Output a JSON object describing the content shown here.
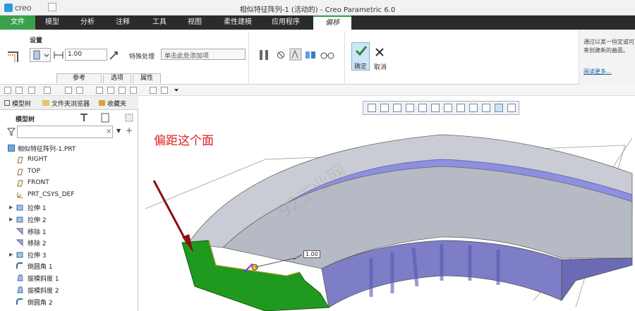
{
  "titlebar": {
    "logo": "creo",
    "title": "相似特征阵列-1 (活动的) - Creo Parametric 6.0"
  },
  "menu": {
    "items": [
      "文件",
      "模型",
      "分析",
      "注释",
      "工具",
      "视图",
      "柔性建模",
      "应用程序",
      "偏移"
    ]
  },
  "ribbon": {
    "settings_label": "设置",
    "distance_value": "1.00",
    "special_label": "特殊处理",
    "special_placeholder": "单击此处添加项",
    "subtabs": [
      "参考",
      "选项",
      "属性"
    ],
    "ok_label": "确定",
    "cancel_label": "取消",
    "hint_text": "通过以某一恒定或可来创建新的曲面。",
    "hint_link": "阅读更多..."
  },
  "panel": {
    "tabs": [
      "模型树",
      "文件夹浏览器",
      "收藏夹"
    ],
    "tree_title": "模型树",
    "items": [
      "相似特征阵列-1.PRT",
      "RIGHT",
      "TOP",
      "FRONT",
      "PRT_CSYS_DEF",
      "拉伸 1",
      "拉伸 2",
      "移除 1",
      "移除 2",
      "拉伸 3",
      "倒圆角 1",
      "拔模斜度 1",
      "拔模斜度 2",
      "倒圆角 2"
    ]
  },
  "viewport": {
    "annotation": "偏距这个面",
    "dimension": "1.00",
    "watermark": "92工业网"
  },
  "colors": {
    "accent": "#3aa14a",
    "menubar": "#2b2b2b",
    "annotation": "#e02020",
    "surface_blue": "#8f8fe0",
    "offset_green": "#1f9a1f"
  }
}
